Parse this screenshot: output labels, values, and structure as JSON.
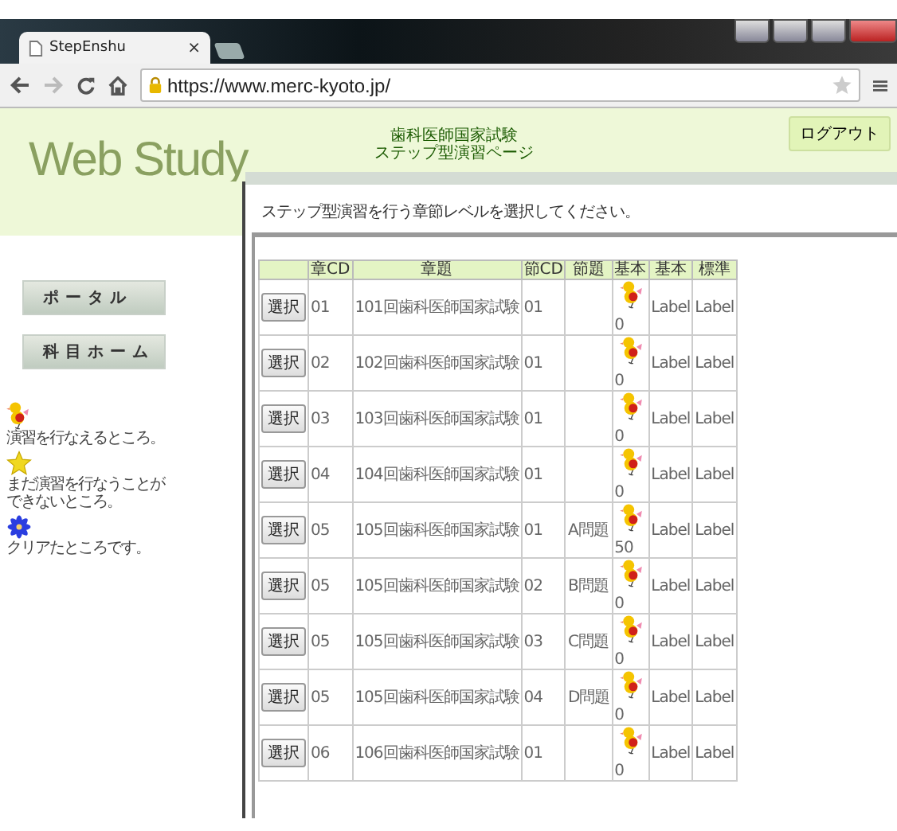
{
  "browser": {
    "tab_title": "StepEnshu",
    "tab_close": "×",
    "url": "https://www.merc-kyoto.jp/"
  },
  "header": {
    "logo": "Web Study",
    "title_lines": [
      "歯科医師国家試験",
      "ステップ型演習ページ"
    ],
    "logout": "ログアウト"
  },
  "sidebar": {
    "nav": [
      "ポータル",
      "科目ホーム"
    ],
    "legend": [
      {
        "kind": "chick",
        "text": "演習を行なえるところ。"
      },
      {
        "kind": "star",
        "text": "まだ演習を行なうことができないところ。"
      },
      {
        "kind": "flower",
        "text": "クリアたところです。"
      }
    ]
  },
  "instruction": "ステップ型演習を行う章節レベルを選択してください。",
  "table": {
    "columns": [
      "",
      "章CD",
      "章題",
      "節CD",
      "節題",
      "基本",
      "基本",
      "標準"
    ],
    "rows": [
      {
        "button": "選択",
        "chapter_cd": "01",
        "chapter_title": "101回歯科医師国家試験",
        "section_cd": "01",
        "score": "0",
        "col7": "Label",
        "col8": "Label"
      },
      {
        "button": "選択",
        "chapter_cd": "02",
        "chapter_title": "102回歯科医師国家試験",
        "section_cd": "01",
        "score": "0",
        "col7": "Label",
        "col8": "Label"
      },
      {
        "button": "選択",
        "chapter_cd": "03",
        "chapter_title": "103回歯科医師国家試験",
        "section_cd": "01",
        "score": "0",
        "col7": "Label",
        "col8": "Label"
      },
      {
        "button": "選択",
        "chapter_cd": "04",
        "chapter_title": "104回歯科医師国家試験",
        "section_cd": "01",
        "score": "0",
        "col7": "Label",
        "col8": "Label"
      },
      {
        "button": "選択",
        "chapter_cd": "05",
        "chapter_title": "105回歯科医師国家試験",
        "section_cd": "01",
        "section_title": "A問題",
        "score": "50",
        "col7": "Label",
        "col8": "Label"
      },
      {
        "button": "選択",
        "chapter_cd": "05",
        "chapter_title": "105回歯科医師国家試験",
        "section_cd": "02",
        "section_title": "B問題",
        "score": "0",
        "col7": "Label",
        "col8": "Label"
      },
      {
        "button": "選択",
        "chapter_cd": "05",
        "chapter_title": "105回歯科医師国家試験",
        "section_cd": "03",
        "section_title": "C問題",
        "score": "0",
        "col7": "Label",
        "col8": "Label"
      },
      {
        "button": "選択",
        "chapter_cd": "05",
        "chapter_title": "105回歯科医師国家試験",
        "section_cd": "04",
        "section_title": "D問題",
        "score": "0",
        "col7": "Label",
        "col8": "Label"
      },
      {
        "button": "選択",
        "chapter_cd": "06",
        "chapter_title": "106回歯科医師国家試験",
        "section_cd": "01",
        "score": "0",
        "col7": "Label",
        "col8": "Label"
      }
    ]
  }
}
